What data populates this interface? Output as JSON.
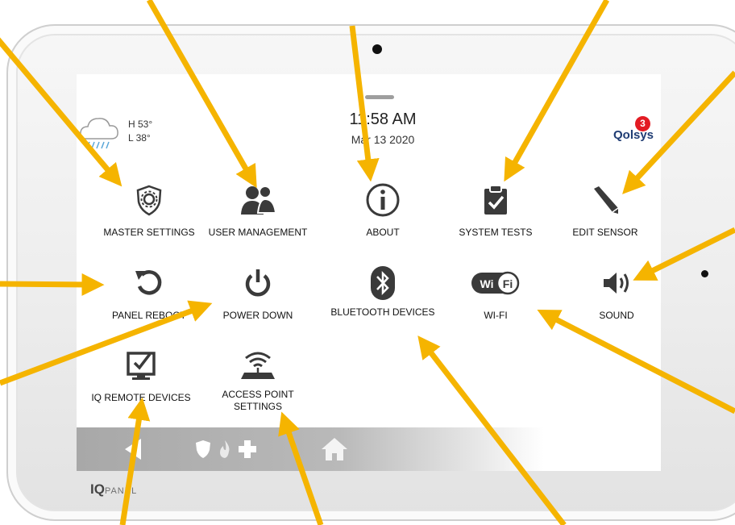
{
  "device": {
    "brand_prefix": "IQ",
    "brand_suffix": "PANEL"
  },
  "header": {
    "weather": {
      "high": "H 53°",
      "low": "L 38°",
      "icon": "rain-cloud-icon"
    },
    "time": "11:58 AM",
    "date": "Mar 13 2020",
    "logo_text": "Qolsys",
    "notification_count": "3"
  },
  "settings": [
    {
      "label": "MASTER SETTINGS",
      "icon": "gear-shield-icon"
    },
    {
      "label": "USER MANAGEMENT",
      "icon": "users-icon"
    },
    {
      "label": "ABOUT",
      "icon": "info-icon"
    },
    {
      "label": "SYSTEM TESTS",
      "icon": "clipboard-check-icon"
    },
    {
      "label": "EDIT SENSOR",
      "icon": "pencil-icon"
    },
    {
      "label": "PANEL REBOOT",
      "icon": "reboot-icon"
    },
    {
      "label": "POWER DOWN",
      "icon": "power-icon"
    },
    {
      "label": "BLUETOOTH DEVICES",
      "icon": "bluetooth-icon"
    },
    {
      "label": "WI-FI",
      "icon": "wifi-icon"
    },
    {
      "label": "SOUND",
      "icon": "speaker-icon"
    },
    {
      "label": "IQ REMOTE DEVICES",
      "icon": "remote-tablet-icon"
    },
    {
      "label": "ACCESS POINT SETTINGS",
      "icon": "router-icon"
    }
  ],
  "navbar": {
    "back_icon": "back-arrow-icon",
    "emergency_icons": [
      "police-shield-icon",
      "fire-icon",
      "medical-cross-icon"
    ],
    "home_icon": "home-icon"
  },
  "colors": {
    "arrow": "#F5B400",
    "badge": "#E31B23",
    "icon": "#3a3a3a",
    "navbar": "#B3B3B3"
  }
}
